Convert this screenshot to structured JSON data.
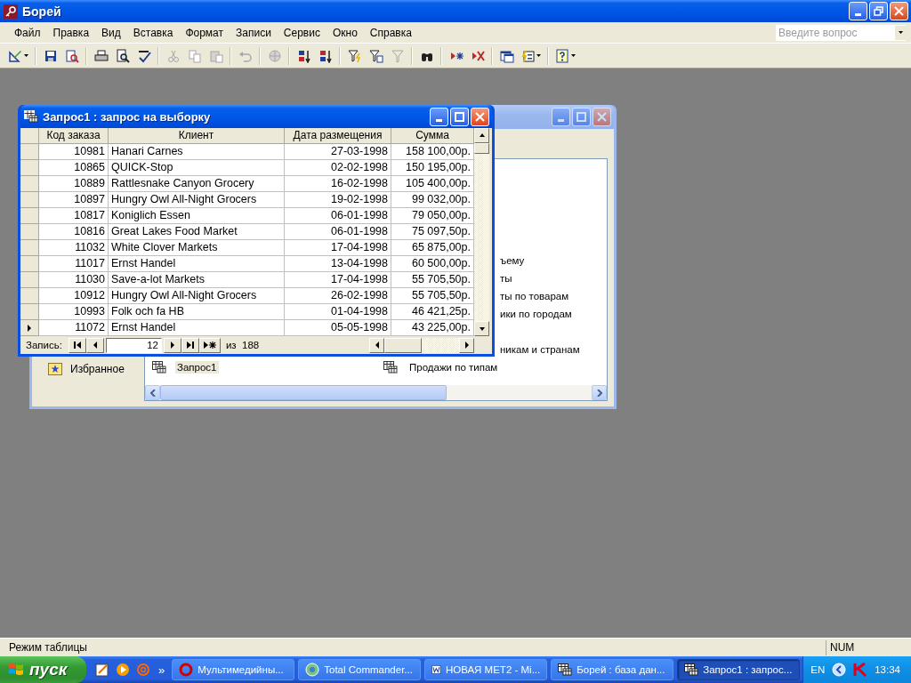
{
  "app": {
    "title": "Борей"
  },
  "menu": [
    "Файл",
    "Правка",
    "Вид",
    "Вставка",
    "Формат",
    "Записи",
    "Сервис",
    "Окно",
    "Справка"
  ],
  "help_box": {
    "placeholder": "Введите вопрос"
  },
  "toolbar": [
    {
      "kind": "design",
      "disabled": false,
      "dropdown": true
    },
    {
      "kind": "separator"
    },
    {
      "kind": "save",
      "disabled": false
    },
    {
      "kind": "file-search",
      "disabled": false
    },
    {
      "kind": "separator"
    },
    {
      "kind": "print",
      "disabled": false
    },
    {
      "kind": "preview",
      "disabled": false
    },
    {
      "kind": "spelling",
      "disabled": false
    },
    {
      "kind": "separator"
    },
    {
      "kind": "cut",
      "disabled": true
    },
    {
      "kind": "copy",
      "disabled": true
    },
    {
      "kind": "paste",
      "disabled": true
    },
    {
      "kind": "separator"
    },
    {
      "kind": "undo",
      "disabled": true
    },
    {
      "kind": "separator"
    },
    {
      "kind": "web",
      "disabled": true
    },
    {
      "kind": "separator"
    },
    {
      "kind": "sort-ascending",
      "disabled": false
    },
    {
      "kind": "sort-descending",
      "disabled": false
    },
    {
      "kind": "separator"
    },
    {
      "kind": "filter-selection",
      "disabled": false
    },
    {
      "kind": "filter-form",
      "disabled": false
    },
    {
      "kind": "filter-apply",
      "disabled": true
    },
    {
      "kind": "separator"
    },
    {
      "kind": "find",
      "disabled": false
    },
    {
      "kind": "separator"
    },
    {
      "kind": "new-record",
      "disabled": false
    },
    {
      "kind": "delete-record",
      "disabled": false
    },
    {
      "kind": "separator"
    },
    {
      "kind": "database-window",
      "disabled": false
    },
    {
      "kind": "new-object",
      "disabled": false,
      "dropdown": true
    },
    {
      "kind": "separator"
    },
    {
      "kind": "help",
      "disabled": false,
      "dropdown": true
    }
  ],
  "database_window": {
    "nav": [
      "Избранное"
    ],
    "rows": [
      {
        "right": {
          "text": "ъему",
          "kind": "fragment"
        }
      },
      {
        "right": {
          "text": "ты",
          "kind": "fragment"
        }
      },
      {
        "right": {
          "text": "ты по товарам",
          "kind": "fragment"
        }
      },
      {
        "right": {
          "text": "ики по городам",
          "kind": "fragment"
        }
      },
      {
        "gap_before": true,
        "right": {
          "text": "никам и странам",
          "kind": "fragment"
        }
      },
      {
        "left": {
          "text": "Запрос1",
          "kind": "item",
          "selected": true
        },
        "right": {
          "text": "Продажи по типам",
          "kind": "item",
          "selected": false
        }
      }
    ]
  },
  "query_window": {
    "title": "Запрос1 : запрос на выборку",
    "columns": [
      "Код заказа",
      "Клиент",
      "Дата размещения",
      "Сумма"
    ],
    "rows": [
      {
        "cells": [
          "10981",
          "Hanari Carnes",
          "27-03-1998",
          "158 100,00р."
        ],
        "selected": false
      },
      {
        "cells": [
          "10865",
          "QUICK-Stop",
          "02-02-1998",
          "150 195,00р."
        ],
        "selected": false
      },
      {
        "cells": [
          "10889",
          "Rattlesnake Canyon Grocery",
          "16-02-1998",
          "105 400,00р."
        ],
        "selected": false
      },
      {
        "cells": [
          "10897",
          "Hungry Owl All-Night Grocers",
          "19-02-1998",
          "99 032,00р."
        ],
        "selected": false
      },
      {
        "cells": [
          "10817",
          "Koniglich Essen",
          "06-01-1998",
          "79 050,00р."
        ],
        "selected": false
      },
      {
        "cells": [
          "10816",
          "Great Lakes Food Market",
          "06-01-1998",
          "75 097,50р."
        ],
        "selected": false
      },
      {
        "cells": [
          "11032",
          "White Clover Markets",
          "17-04-1998",
          "65 875,00р."
        ],
        "selected": false
      },
      {
        "cells": [
          "11017",
          "Ernst Handel",
          "13-04-1998",
          "60 500,00р."
        ],
        "selected": false
      },
      {
        "cells": [
          "11030",
          "Save-a-lot Markets",
          "17-04-1998",
          "55 705,50р."
        ],
        "selected": false
      },
      {
        "cells": [
          "10912",
          "Hungry Owl All-Night Grocers",
          "26-02-1998",
          "55 705,50р."
        ],
        "selected": false
      },
      {
        "cells": [
          "10993",
          "Folk och fa HB",
          "01-04-1998",
          "46 421,25р."
        ],
        "selected": false
      },
      {
        "cells": [
          "11072",
          "Ernst Handel",
          "05-05-1998",
          "43 225,00р."
        ],
        "selected": true
      }
    ],
    "navigator": {
      "label": "Запись:",
      "current": "12",
      "total": "из  188"
    }
  },
  "status_bar": {
    "text": "Режим таблицы",
    "indicator": "NUM"
  },
  "taskbar": {
    "start": "пуск",
    "more": "»",
    "tasks": [
      {
        "label": "Мультимедийны...",
        "kind": "browser",
        "selected": false
      },
      {
        "label": "Total Commander...",
        "kind": "commander",
        "selected": false
      },
      {
        "label": "НОВАЯ МЕТ2 - Mi...",
        "kind": "word",
        "selected": false
      },
      {
        "label": "Борей : база дан...",
        "kind": "database",
        "selected": false
      },
      {
        "label": "Запрос1 : запрос...",
        "kind": "query",
        "selected": true
      }
    ],
    "language": "EN",
    "clock": "13:34"
  }
}
